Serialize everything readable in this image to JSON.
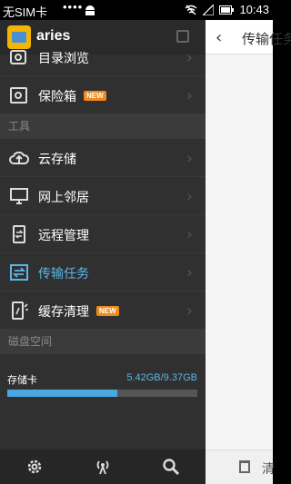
{
  "status_bar": {
    "carrier": "无SIM卡",
    "time": "10:43",
    "icons": [
      "sim-dots-icon",
      "android-icon",
      "wifi-off-icon",
      "signal-icon",
      "battery-icon"
    ]
  },
  "drawer": {
    "app_name": "aries",
    "items_top": [
      {
        "label": "目录浏览",
        "icon": "folder-icon",
        "new": false
      },
      {
        "label": "保险箱",
        "icon": "safe-icon",
        "new": true
      }
    ],
    "section_tools": "工具",
    "items_tools": [
      {
        "label": "云存储",
        "icon": "cloud-upload-icon",
        "new": false
      },
      {
        "label": "网上邻居",
        "icon": "monitor-icon",
        "new": false
      },
      {
        "label": "远程管理",
        "icon": "phone-sync-icon",
        "new": false
      },
      {
        "label": "传输任务",
        "icon": "transfer-icon",
        "new": false,
        "active": true
      },
      {
        "label": "缓存清理",
        "icon": "phone-clean-icon",
        "new": true
      }
    ],
    "new_badge": "NEW",
    "section_disk": "磁盘空间",
    "storage": {
      "name": "存储卡",
      "size": "5.42GB/9.37GB",
      "used_fraction": 0.578
    },
    "bottom_icons": [
      "settings-icon",
      "wifi-share-icon",
      "search-icon"
    ]
  },
  "content": {
    "title": "传输任务",
    "bottom_label": "清"
  },
  "colors": {
    "accent": "#5ab6e8",
    "badge": "#f08a1a",
    "drawer_bg": "#303030"
  }
}
